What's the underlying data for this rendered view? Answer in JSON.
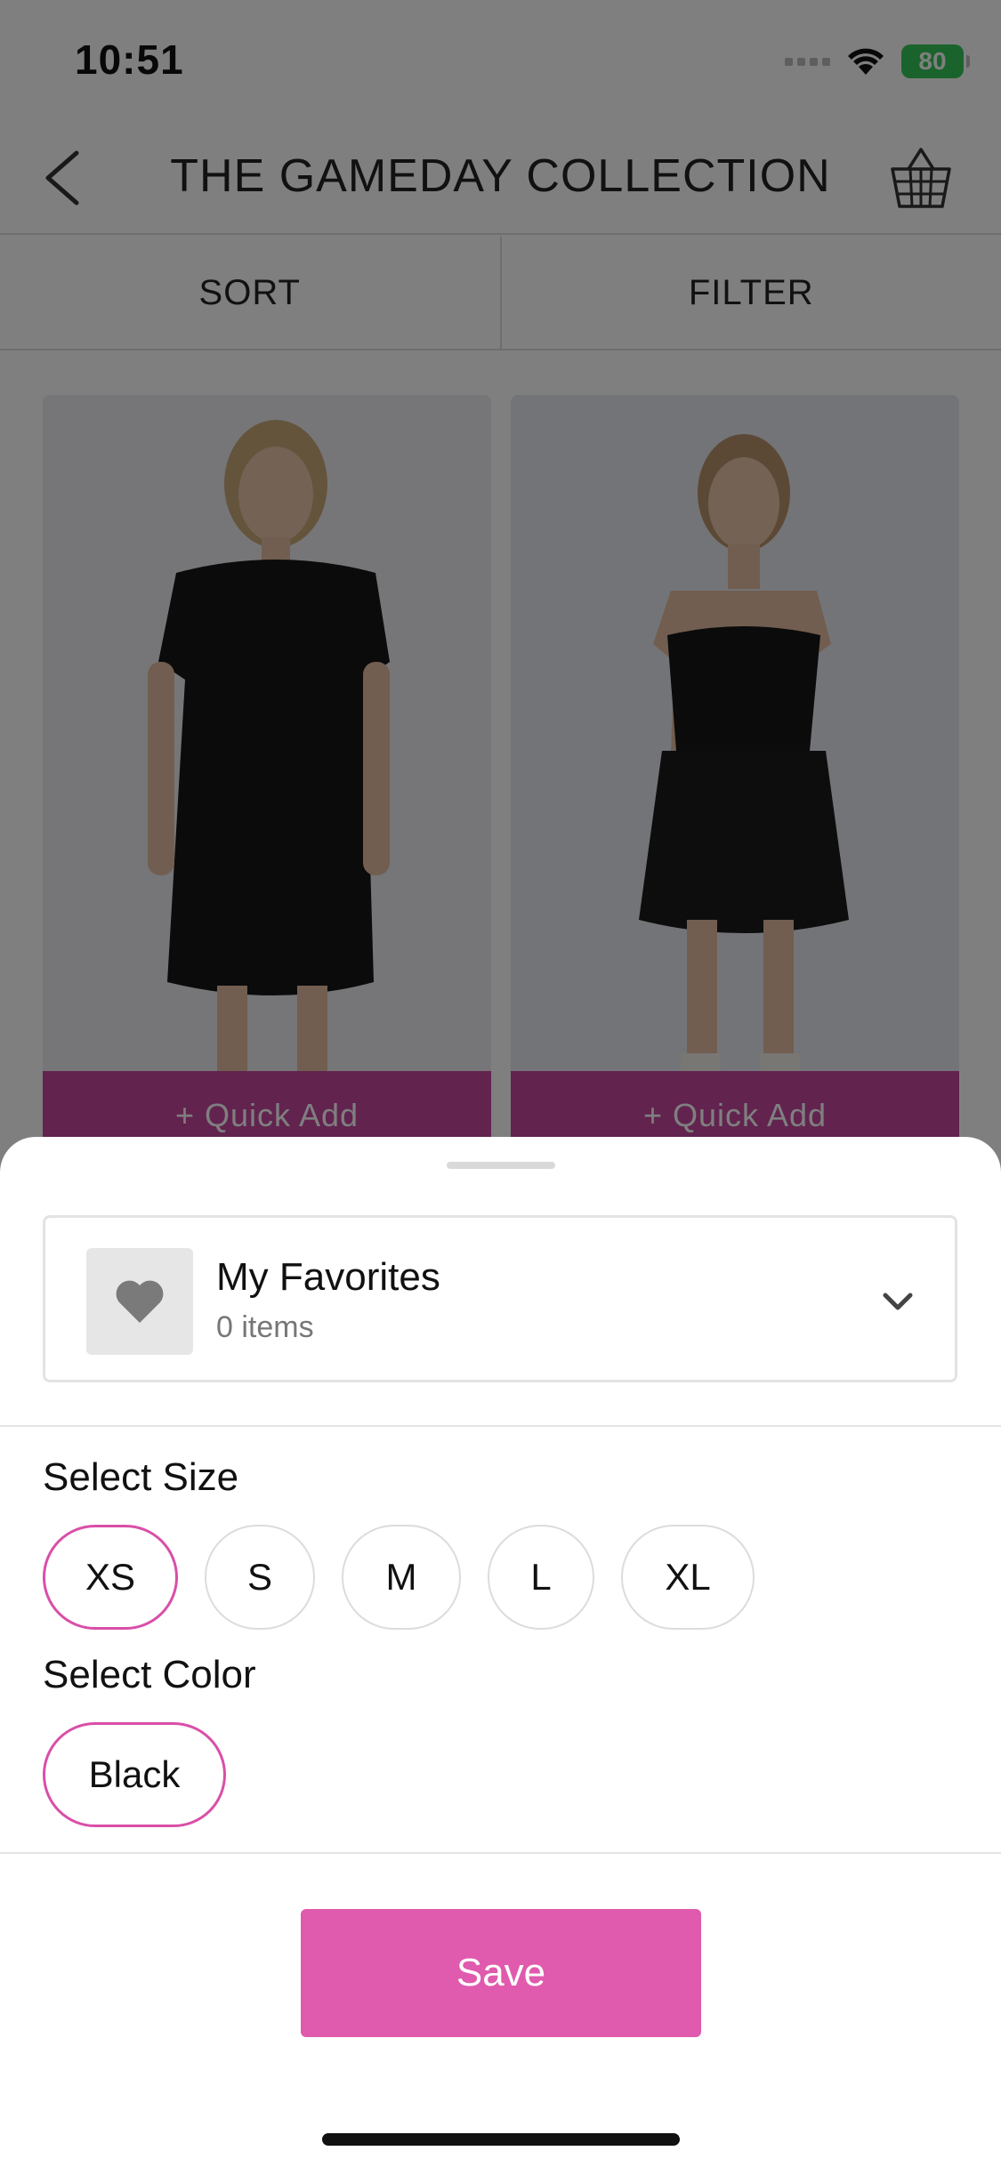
{
  "status_bar": {
    "time": "10:51",
    "battery": "80"
  },
  "header": {
    "title": "THE GAMEDAY COLLECTION"
  },
  "toolbar": {
    "sort_label": "SORT",
    "filter_label": "FILTER"
  },
  "products": [
    {
      "quick_add_label": "+ Quick Add"
    },
    {
      "quick_add_label": "+ Quick Add"
    }
  ],
  "sheet": {
    "list": {
      "name": "My Favorites",
      "count": "0 items"
    },
    "size_label": "Select Size",
    "sizes": [
      {
        "label": "XS",
        "selected": true
      },
      {
        "label": "S",
        "selected": false
      },
      {
        "label": "M",
        "selected": false
      },
      {
        "label": "L",
        "selected": false
      },
      {
        "label": "XL",
        "selected": false
      }
    ],
    "color_label": "Select Color",
    "colors": [
      {
        "label": "Black",
        "selected": true
      }
    ],
    "save_label": "Save"
  },
  "theme": {
    "accent": "#e05aad",
    "selected_border": "#d94fa8",
    "quick_add_bg": "#c4479f"
  }
}
